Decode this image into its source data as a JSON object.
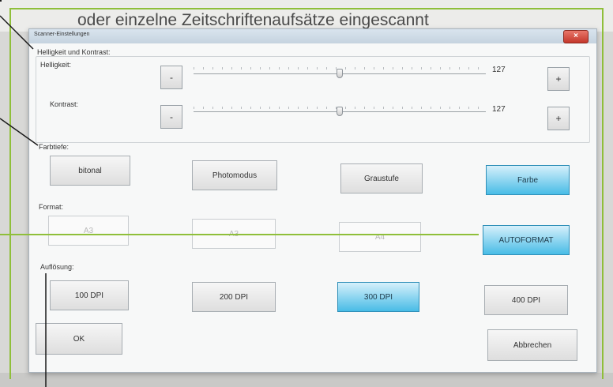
{
  "background": {
    "line1": "oder einzelne Zeitschriftenaufsätze eingescannt",
    "line2": "oder einzelne Zeitschriftenaufsätze eingescannt"
  },
  "dialog": {
    "title": "Scanner-Einstellungen",
    "close_symbol": "×"
  },
  "brightness_contrast": {
    "section_label": "Helligkeit und Kontrast:",
    "brightness": {
      "label": "Helligkeit:",
      "value": "127",
      "minus": "-",
      "plus": "+",
      "level": 0.5
    },
    "contrast": {
      "label": "Kontrast:",
      "value": "127",
      "minus": "-",
      "plus": "+",
      "level": 0.5
    }
  },
  "color_depth": {
    "section_label": "Farbtiefe:",
    "options": [
      "bitonal",
      "Photomodus",
      "Graustufe",
      "Farbe"
    ],
    "selected": "Farbe"
  },
  "format": {
    "section_label": "Format:",
    "options": [
      "A3",
      "A3",
      "A4",
      "AUTOFORMAT"
    ],
    "selected": "AUTOFORMAT"
  },
  "resolution": {
    "section_label": "Auflösung:",
    "options": [
      "100 DPI",
      "200 DPI",
      "300 DPI",
      "400 DPI"
    ],
    "selected": "300 DPI"
  },
  "buttons": {
    "ok": "OK",
    "cancel": "Abbrechen"
  },
  "colors": {
    "accent": "#48bce6",
    "frame": "#8fbf3a"
  }
}
